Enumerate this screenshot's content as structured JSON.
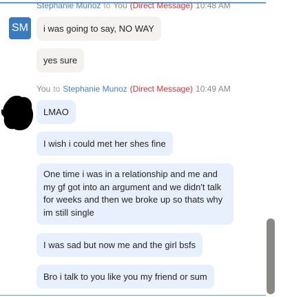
{
  "header_partial": {
    "sender": "Stephanie Munoz",
    "to": "to",
    "recipient": "You",
    "dm_label": "(Direct Message)",
    "time": "10:48 AM"
  },
  "incoming": {
    "avatar_initials": "SM",
    "messages": [
      "i was going to say, NO WAY",
      "yes sure"
    ]
  },
  "outgoing": {
    "sender": "You",
    "to": "to",
    "recipient": "Stephanie Munoz",
    "dm_label": "(Direct Message)",
    "time": "10:49 AM",
    "messages": [
      "LMAO",
      "I wish i could met her shes fine",
      "One time i was in a relationship and me and my gf got into an argument and we didn't talk for weeks and then we broke up so thats why im still single",
      "I was sad but now me and the girl bsfs",
      "Bro i talk to you like you my friend or sum"
    ]
  },
  "colors": {
    "accent": "#5b9bd5",
    "avatar_bg": "#3a7bbf",
    "dm_red": "#d13438",
    "incoming_bubble": "#f3f2f1",
    "outgoing_bubble": "#e8f0fd"
  }
}
